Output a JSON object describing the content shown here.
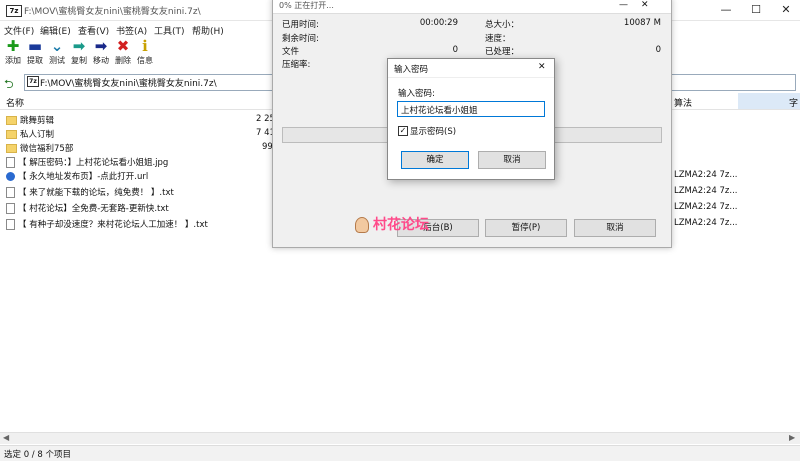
{
  "window": {
    "title": "F:\\MOV\\蜜桃臀女友nini\\蜜桃臀女友nini.7z\\",
    "icon_text": "7z",
    "minimize": "—",
    "maximize": "☐",
    "close": "✕"
  },
  "menu": [
    "文件(F)",
    "编辑(E)",
    "查看(V)",
    "书签(A)",
    "工具(T)",
    "帮助(H)"
  ],
  "toolbar": [
    {
      "label": "添加",
      "icon": "plus-icon",
      "glyph": "✚",
      "color": "#1a9a1a"
    },
    {
      "label": "提取",
      "icon": "minus-icon",
      "glyph": "▬",
      "color": "#1a3a9a"
    },
    {
      "label": "测试",
      "icon": "check-icon",
      "glyph": "⌄",
      "color": "#1a7aaa"
    },
    {
      "label": "复制",
      "icon": "copy-arrow-icon",
      "glyph": "➡",
      "color": "#1a9a8a"
    },
    {
      "label": "移动",
      "icon": "move-arrow-icon",
      "glyph": "➡",
      "color": "#1a2a8a"
    },
    {
      "label": "删除",
      "icon": "delete-icon",
      "glyph": "✖",
      "color": "#d22020"
    },
    {
      "label": "信息",
      "icon": "info-icon",
      "glyph": "ℹ",
      "color": "#c8a000"
    }
  ],
  "address": {
    "icon_text": "7z",
    "path": "F:\\MOV\\蜜桃臀女友nini\\蜜桃臀女友nini.7z\\"
  },
  "columns": {
    "name": "名称",
    "method": "算法",
    "extra": "字"
  },
  "files": [
    {
      "type": "folder",
      "name": "跳舞剪辑",
      "size": "2 25",
      "method": ""
    },
    {
      "type": "folder",
      "name": "私人订制",
      "size": "7 41",
      "method": ""
    },
    {
      "type": "folder",
      "name": "微信福利75部",
      "size": "99",
      "method": ""
    },
    {
      "type": "file",
      "name": "【 解压密码：】上村花论坛看小姐姐.jpg",
      "size": "",
      "method": ""
    },
    {
      "type": "globe",
      "name": "【 永久地址发布页】-点此打开.url",
      "size": "",
      "method": "LZMA2:24 7z..."
    },
    {
      "type": "file",
      "name": "【 来了就能下载的论坛，纯免费！ 】.txt",
      "size": "",
      "method": "LZMA2:24 7z..."
    },
    {
      "type": "file",
      "name": "【 村花论坛】全免费-无套路-更新快.txt",
      "size": "",
      "method": "LZMA2:24 7z..."
    },
    {
      "type": "file",
      "name": "【 有种子却没速度？来村花论坛人工加速！ 】.txt",
      "size": "",
      "method": "LZMA2:24 7z..."
    }
  ],
  "status": "选定 0 / 8 个项目",
  "progress": {
    "title": "0% 正在打开...",
    "elapsed_label": "已用时间:",
    "elapsed_value": "00:00:29",
    "remaining_label": "剩余时间:",
    "remaining_value": "",
    "files_label": "文件",
    "files_value": "0",
    "ratio_label": "压缩率:",
    "ratio_value": "",
    "total_label": "总大小：",
    "total_value": "10087 M",
    "speed_label": "速度：",
    "speed_value": "",
    "processed_label": "已处理：",
    "processed_value": "0",
    "bg_button": "后台(B)",
    "pause_button": "暂停(P)",
    "cancel_button": "取消"
  },
  "password_dialog": {
    "title": "输入密码",
    "label": "输入密码:",
    "value": "上村花论坛看小姐姐",
    "show_label": "显示密码(S)",
    "ok": "确定",
    "cancel": "取消",
    "close": "✕"
  },
  "watermark": "村花论坛"
}
